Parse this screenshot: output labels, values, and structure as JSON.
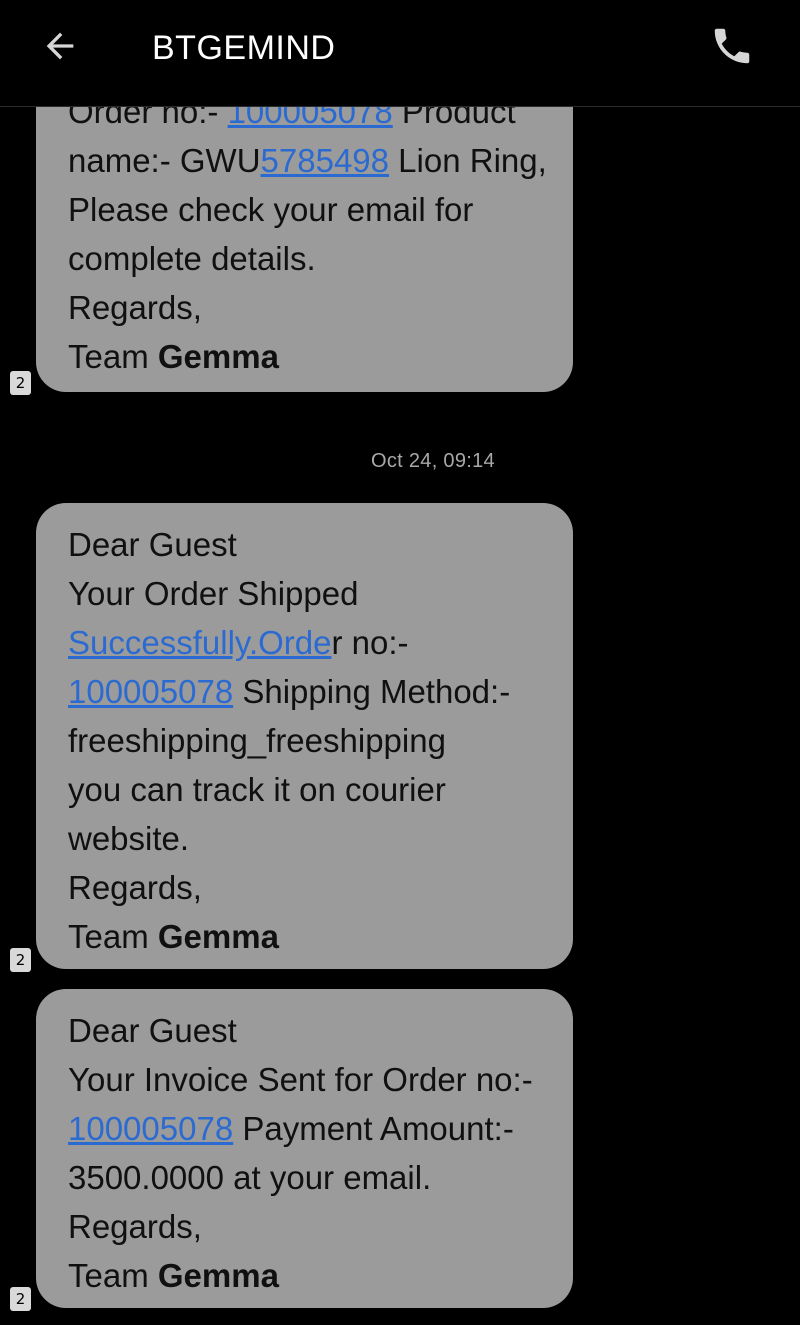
{
  "header": {
    "title": "BTGEMIND",
    "back_icon": "arrow-left-icon",
    "call_icon": "phone-icon"
  },
  "messages": [
    {
      "id": "msg1",
      "sim": "2",
      "line1_prefix": "Order no:- ",
      "line1_link": "100005078",
      "line1_suffix": " Product",
      "line2_prefix": "name:- GWU",
      "line2_link": "5785498",
      "line2_suffix": " Lion Ring,",
      "line3": "Please check your email for",
      "line4": "complete details.",
      "regards": "Regards,",
      "team_prefix": "Team ",
      "team_name": "Gemma"
    },
    {
      "id": "msg2",
      "sim": "2",
      "greeting": "Dear Guest",
      "line1": "Your Order Shipped",
      "line2_link": "Successfully.Orde",
      "line2_suffix": "r no:-",
      "line3_link": "100005078",
      "line3_suffix": " Shipping Method:-",
      "line4": "freeshipping_freeshipping",
      "line5": "you can track it on courier",
      "line6": "website.",
      "regards": "Regards,",
      "team_prefix": "Team ",
      "team_name": "Gemma"
    },
    {
      "id": "msg3",
      "sim": "2",
      "greeting": "Dear Guest",
      "line1": "Your Invoice Sent for Order no:-",
      "line2_link": "100005078",
      "line2_suffix": " Payment Amount:-",
      "line3": "3500.0000 at your email.",
      "regards": "Regards,",
      "team_prefix": "Team ",
      "team_name": "Gemma"
    }
  ],
  "timestamp": "Oct 24, 09:14",
  "colors": {
    "background": "#000000",
    "bubble": "#9b9b9b",
    "link": "#2b6bd1",
    "text": "#101010",
    "timestamp": "#a8a8a8"
  }
}
